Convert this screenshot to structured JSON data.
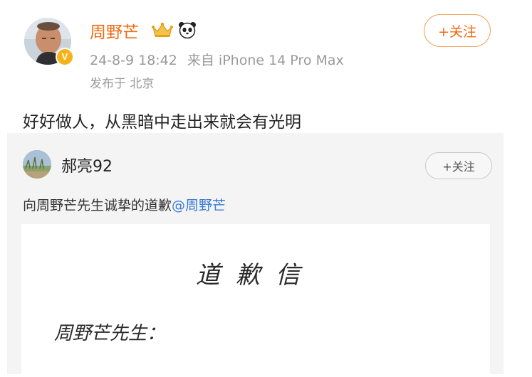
{
  "post": {
    "author": {
      "name": "周野芒",
      "verified": true,
      "badges": [
        "crown-icon",
        "panda-icon"
      ]
    },
    "time": "24-8-9 18:42",
    "source": "来自 iPhone 14 Pro Max",
    "location": "发布于 北京",
    "follow_label": "+关注",
    "text": "好好做人，从黑暗中走出来就会有光明"
  },
  "repost": {
    "author": {
      "name": "郝亮92"
    },
    "follow_label": "+关注",
    "text": "向周野芒先生诚挚的道歉",
    "mention": "@周野芒",
    "letter": {
      "title": "道歉信",
      "salutation": "周野芒先生："
    }
  },
  "colors": {
    "username": "#f06a10",
    "mention": "#3a7bd5",
    "meta": "#9a9a9a",
    "repost_bg": "#f4f4f4",
    "verified_badge": "#f5b21a"
  }
}
